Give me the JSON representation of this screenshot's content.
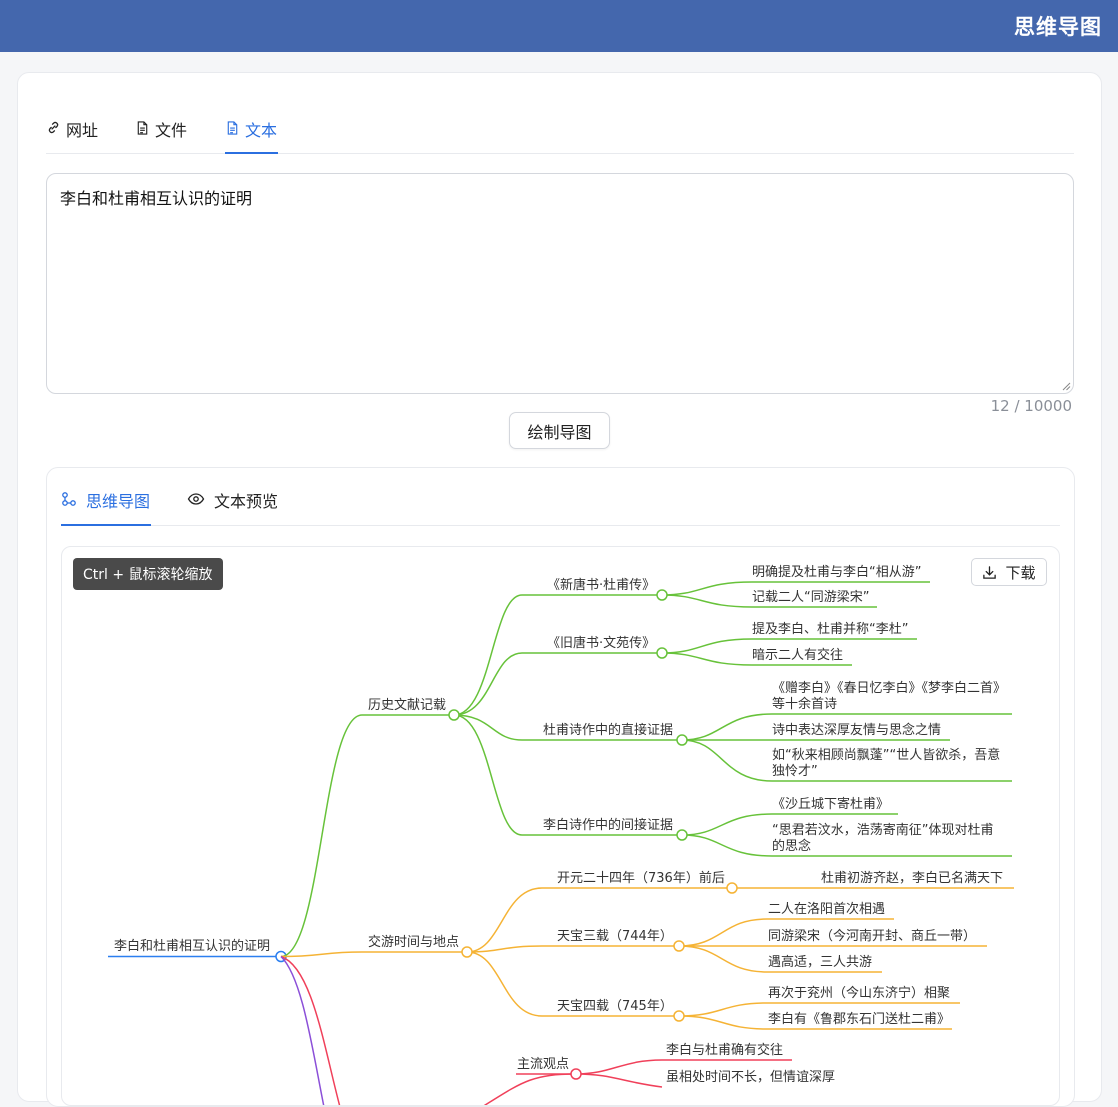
{
  "app": {
    "title": "思维导图"
  },
  "input_tabs": [
    {
      "label": "网址",
      "icon": "link-icon"
    },
    {
      "label": "文件",
      "icon": "file-icon"
    },
    {
      "label": "文本",
      "icon": "text-file-icon",
      "active": true
    }
  ],
  "textarea": {
    "value": "李白和杜甫相互认识的证明"
  },
  "counter": "12 / 10000",
  "draw_button": "绘制导图",
  "result_tabs": [
    {
      "label": "思维导图",
      "icon": "mindmap-icon",
      "active": true
    },
    {
      "label": "文本预览",
      "icon": "eye-icon"
    }
  ],
  "map": {
    "hint": "Ctrl + 鼠标滚轮缩放",
    "download_label": "下载",
    "root": "李白和杜甫相互认识的证明",
    "branches": [
      {
        "label": "历史文献记载",
        "color": "#67c23a",
        "children": [
          {
            "label": "《新唐书·杜甫传》",
            "children": [
              "明确提及杜甫与李白“相从游”",
              "记载二人“同游梁宋”"
            ]
          },
          {
            "label": "《旧唐书·文苑传》",
            "children": [
              "提及李白、杜甫并称“李杜”",
              "暗示二人有交往"
            ]
          },
          {
            "label": "杜甫诗作中的直接证据",
            "children": [
              "《赠李白》《春日忆李白》《梦李白二首》等十余首诗",
              "诗中表达深厚友情与思念之情",
              "如“秋来相顾尚飘蓬”“世人皆欲杀，吾意独怜才”"
            ]
          },
          {
            "label": "李白诗作中的间接证据",
            "children": [
              "《沙丘城下寄杜甫》",
              "“思君若汶水，浩荡寄南征”体现对杜甫的思念"
            ]
          }
        ]
      },
      {
        "label": "交游时间与地点",
        "color": "#f5b335",
        "children": [
          {
            "label": "开元二十四年（736年）前后",
            "children": [
              "杜甫初游齐赵，李白已名满天下"
            ]
          },
          {
            "label": "天宝三载（744年）",
            "children": [
              "二人在洛阳首次相遇",
              "同游梁宋（今河南开封、商丘一带）",
              "遇高适，三人共游"
            ]
          },
          {
            "label": "天宝四载（745年）",
            "children": [
              "再次于兖州（今山东济宁）相聚",
              "李白有《鲁郡东石门送杜二甫》"
            ]
          }
        ]
      },
      {
        "label": "主流观点",
        "color": "#f0405a",
        "children": [
          {
            "label": "李白与杜甫确有交往",
            "children": []
          },
          {
            "label": "虽相处时间不长，但情谊深厚",
            "children": []
          }
        ]
      }
    ]
  }
}
